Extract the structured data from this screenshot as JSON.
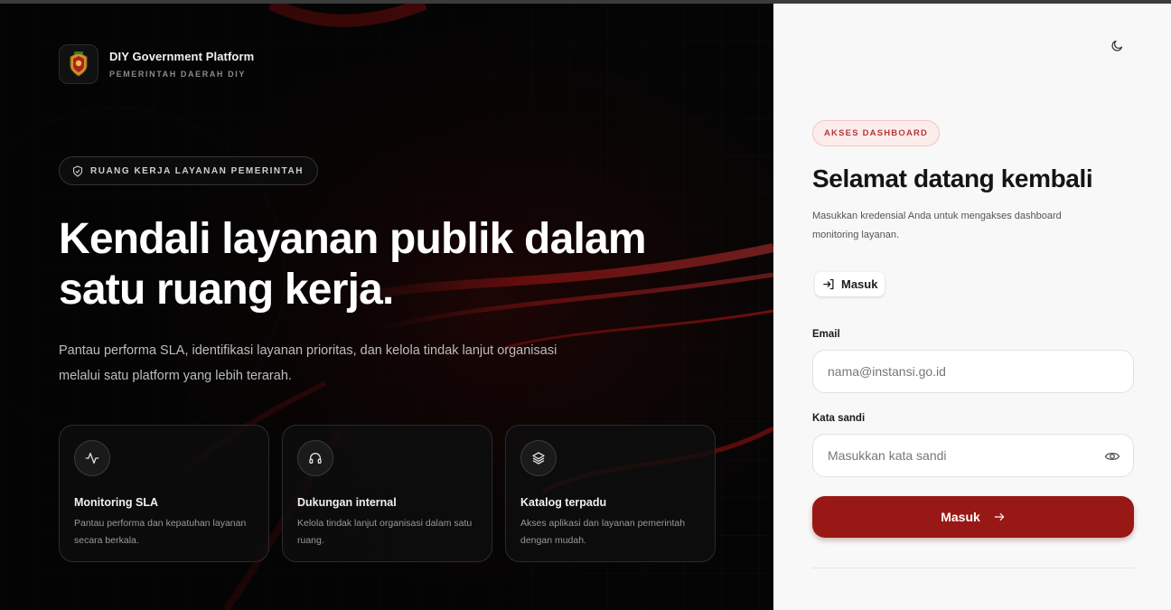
{
  "brand": {
    "title": "DIY Government Platform",
    "subtitle": "PEMERINTAH DAERAH DIY"
  },
  "hero": {
    "pill": "RUANG KERJA LAYANAN PEMERINTAH",
    "title": "Kendali layanan publik dalam satu ruang kerja.",
    "description": "Pantau performa SLA, identifikasi layanan prioritas, dan kelola tindak lanjut organisasi melalui satu platform yang lebih terarah."
  },
  "features": [
    {
      "icon": "activity-icon",
      "title": "Monitoring SLA",
      "description": "Pantau performa dan kepatuhan layanan secara berkala."
    },
    {
      "icon": "headphones-icon",
      "title": "Dukungan internal",
      "description": "Kelola tindak lanjut organisasi dalam satu ruang."
    },
    {
      "icon": "layers-icon",
      "title": "Katalog terpadu",
      "description": "Akses aplikasi dan layanan pemerintah dengan mudah."
    }
  ],
  "login": {
    "badge": "AKSES DASHBOARD",
    "title": "Selamat datang kembali",
    "description": "Masukkan kredensial Anda untuk mengakses dashboard monitoring layanan.",
    "tab_label": "Masuk",
    "email_label": "Email",
    "email_placeholder": "nama@instansi.go.id",
    "email_value": "",
    "password_label": "Kata sandi",
    "password_placeholder": "Masukkan kata sandi",
    "password_value": "",
    "submit_label": "Masuk"
  },
  "colors": {
    "accent": "#981815",
    "badge_bg": "#fdecec",
    "panel_bg": "#f8f8f8",
    "dark_bg": "#050505"
  }
}
